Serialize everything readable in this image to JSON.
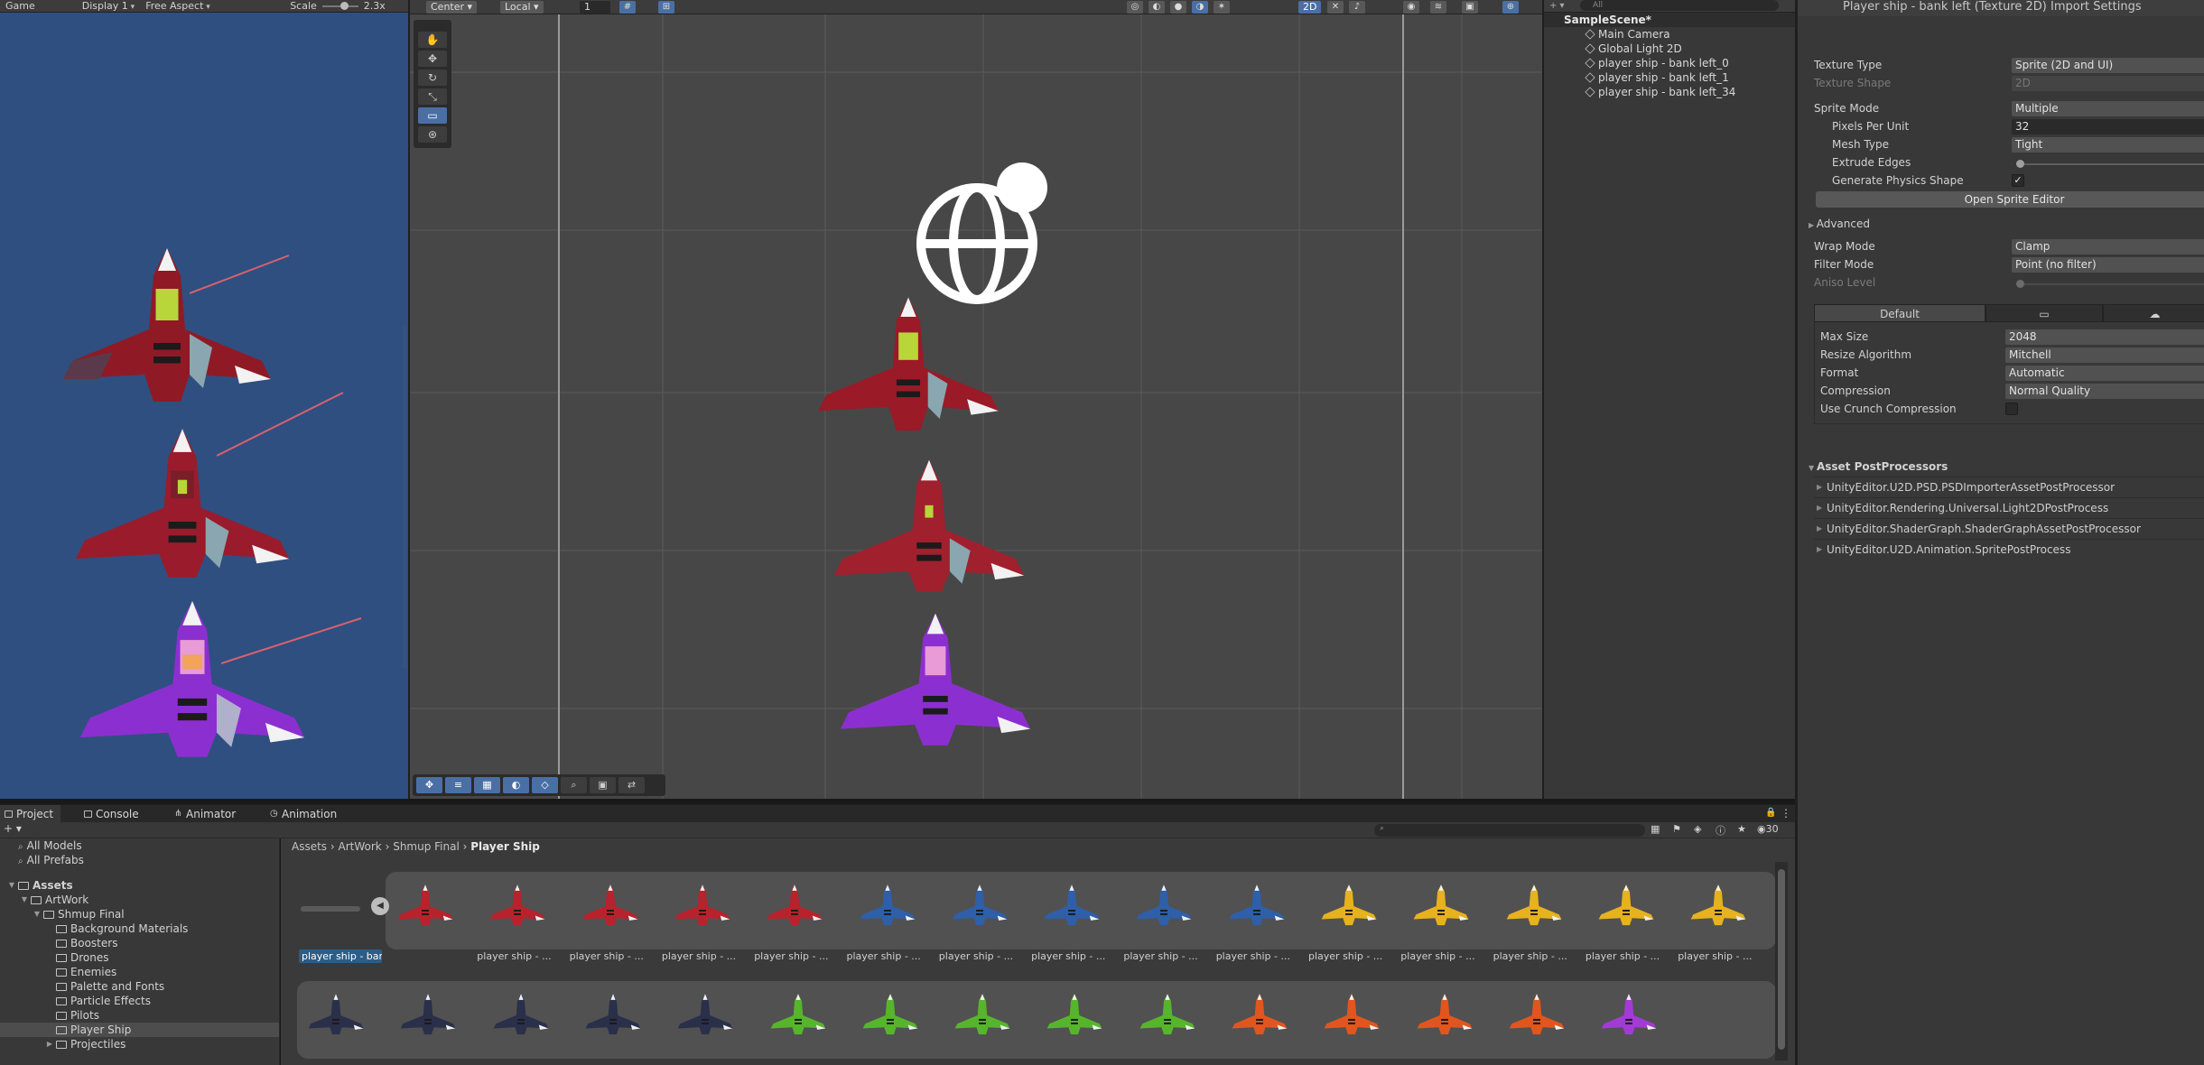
{
  "game_view": {
    "tab_partial": "Game",
    "display": "Display 1",
    "aspect": "Free Aspect",
    "scale_label": "Scale",
    "scale_value": "2.3x"
  },
  "scene_view": {
    "pivot": "Center",
    "space": "Local",
    "snap_value": "1",
    "mode_2d": "2D"
  },
  "hierarchy": {
    "search_placeholder": "All",
    "scene_name": "SampleScene*",
    "items": [
      {
        "label": "Main Camera"
      },
      {
        "label": "Global Light 2D"
      },
      {
        "label": "player ship - bank left_0"
      },
      {
        "label": "player ship - bank left_1"
      },
      {
        "label": "player ship - bank left_34"
      }
    ]
  },
  "inspector": {
    "title": "Player ship - bank left (Texture 2D) Import Settings",
    "texture_type_label": "Texture Type",
    "texture_type": "Sprite (2D and UI)",
    "texture_shape_label": "Texture Shape",
    "texture_shape": "2D",
    "sprite_mode_label": "Sprite Mode",
    "sprite_mode": "Multiple",
    "ppu_label": "Pixels Per Unit",
    "ppu": "32",
    "mesh_type_label": "Mesh Type",
    "mesh_type": "Tight",
    "extrude_label": "Extrude Edges",
    "physics_label": "Generate Physics Shape",
    "physics_checked": "✓",
    "open_sprite_editor": "Open Sprite Editor",
    "advanced_label": "Advanced",
    "wrap_label": "Wrap Mode",
    "wrap_mode": "Clamp",
    "filter_label": "Filter Mode",
    "filter_mode": "Point (no filter)",
    "aniso_label": "Aniso Level",
    "platform_tabs": [
      "Default",
      "",
      ""
    ],
    "max_size_label": "Max Size",
    "max_size": "2048",
    "resize_label": "Resize Algorithm",
    "resize": "Mitchell",
    "format_label": "Format",
    "format": "Automatic",
    "compression_label": "Compression",
    "compression": "Normal Quality",
    "crunch_label": "Use Crunch Compression",
    "postprocessors_label": "Asset PostProcessors",
    "postprocessors": [
      "UnityEditor.U2D.PSD.PSDImporterAssetPostProcessor",
      "UnityEditor.Rendering.Universal.Light2DPostProcess",
      "UnityEditor.ShaderGraph.ShaderGraphAssetPostProcessor",
      "UnityEditor.U2D.Animation.SpritePostProcess"
    ]
  },
  "bottom_tabs": [
    "Project",
    "Console",
    "Animator",
    "Animation"
  ],
  "project": {
    "count": "30",
    "favorites": [
      "All Models",
      "All Prefabs"
    ],
    "tree": [
      {
        "label": "Assets",
        "depth": 0,
        "bold": true
      },
      {
        "label": "ArtWork",
        "depth": 1
      },
      {
        "label": "Shmup Final",
        "depth": 2
      },
      {
        "label": "Background Materials",
        "depth": 3
      },
      {
        "label": "Boosters",
        "depth": 3
      },
      {
        "label": "Drones",
        "depth": 3
      },
      {
        "label": "Enemies",
        "depth": 3
      },
      {
        "label": "Palette and Fonts",
        "depth": 3
      },
      {
        "label": "Particle Effects",
        "depth": 3
      },
      {
        "label": "Pilots",
        "depth": 3
      },
      {
        "label": "Player Ship",
        "depth": 3,
        "selected": true
      },
      {
        "label": "Projectiles",
        "depth": 3
      }
    ],
    "breadcrumb": [
      "Assets",
      "ArtWork",
      "Shmup Final",
      "Player Ship"
    ],
    "selected_label": "player ship - ban...",
    "cell_label": "player ship - ...",
    "row1_colors": [
      "#b8222c",
      "#b8222c",
      "#b8222c",
      "#b8222c",
      "#b8222c",
      "#2e5fa8",
      "#2e5fa8",
      "#2e5fa8",
      "#2e5fa8",
      "#2e5fa8",
      "#e6b21e",
      "#e6b21e",
      "#e6b21e",
      "#e6b21e",
      "#e6b21e"
    ],
    "row2_colors": [
      "#2a2f4a",
      "#2a2f4a",
      "#2a2f4a",
      "#2a2f4a",
      "#2a2f4a",
      "#57b52c",
      "#57b52c",
      "#57b52c",
      "#57b52c",
      "#57b52c",
      "#e0561e",
      "#e0561e",
      "#e0561e",
      "#e0561e",
      "#a23ad6"
    ]
  }
}
